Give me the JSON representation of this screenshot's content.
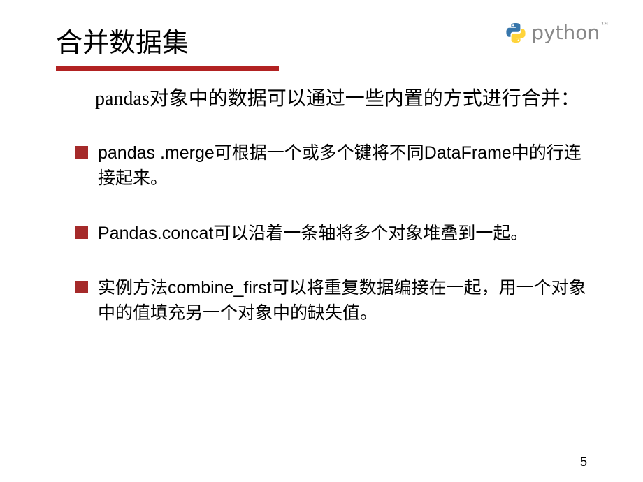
{
  "header": {
    "title": "合并数据集",
    "logoText": "python",
    "logoTm": "™"
  },
  "intro": "pandas对象中的数据可以通过一些内置的方式进行合并：",
  "bullets": [
    "pandas .merge可根据一个或多个键将不同DataFrame中的行连接起来。",
    "Pandas.concat可以沿着一条轴将多个对象堆叠到一起。",
    "实例方法combine_first可以将重复数据编接在一起，用一个对象中的值填充另一个对象中的缺失值。"
  ],
  "pageNumber": "5"
}
